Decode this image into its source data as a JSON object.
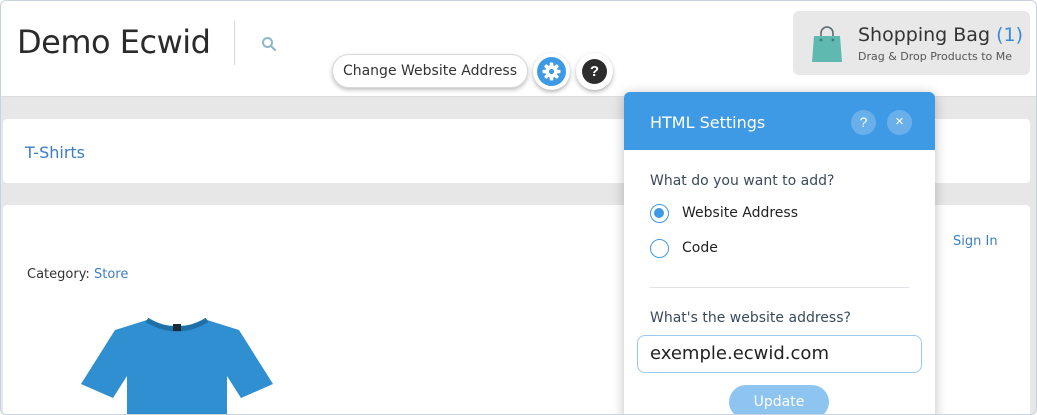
{
  "header": {
    "site_title": "Demo Ecwid",
    "cart": {
      "title": "Shopping Bag",
      "count": "(1)",
      "subtitle": "Drag & Drop Products to Me"
    }
  },
  "toolbar": {
    "change_address_label": "Change Website Address",
    "help_label": "?"
  },
  "content": {
    "breadcrumb_link": "T-Shirts",
    "sign_in": "Sign In",
    "category_label": "Category:",
    "category_value": "Store"
  },
  "panel": {
    "title": "HTML Settings",
    "help_label": "?",
    "close_label": "×",
    "question_add": "What do you want to add?",
    "options": [
      {
        "label": "Website Address",
        "checked": true
      },
      {
        "label": "Code",
        "checked": false
      }
    ],
    "question_address": "What's the website address?",
    "address_value": "exemple.ecwid.com",
    "update_label": "Update"
  },
  "colors": {
    "accent": "#3f9ae6",
    "link": "#3b7dc4",
    "shirt": "#2f8fd0"
  }
}
